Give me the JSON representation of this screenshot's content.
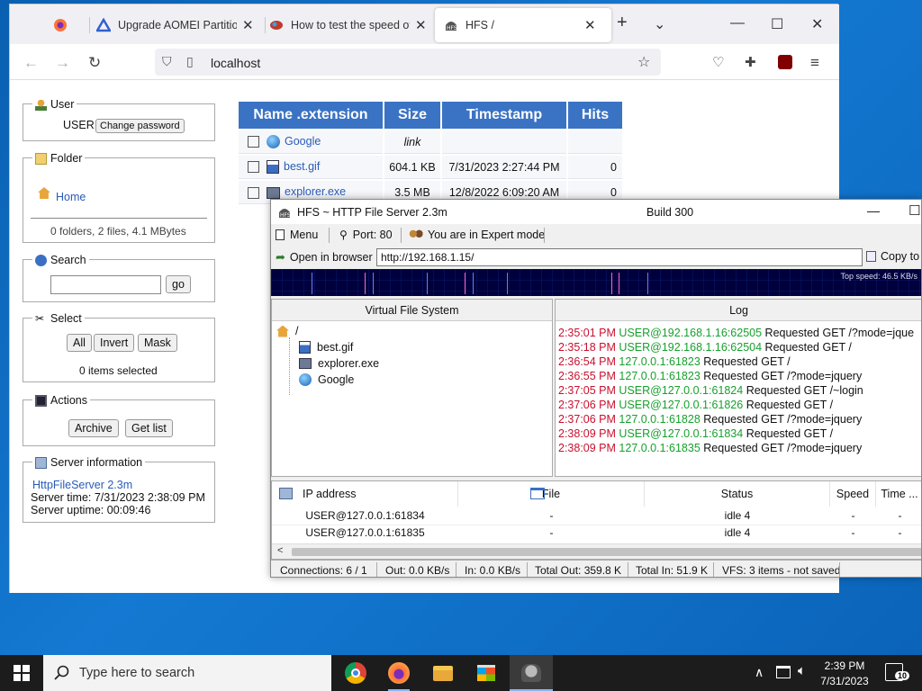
{
  "browser": {
    "tabs": [
      {
        "label": "Upgrade AOMEI Partition"
      },
      {
        "label": "How to test the speed of"
      },
      {
        "label": "HFS /"
      }
    ],
    "address": "localhost"
  },
  "page": {
    "user": {
      "legend": "User",
      "name": "USER",
      "change_password": "Change password"
    },
    "folder": {
      "legend": "Folder",
      "home": "Home",
      "summary": "0 folders, 2 files, 4.1 MBytes"
    },
    "search": {
      "legend": "Search",
      "go": "go"
    },
    "select": {
      "legend": "Select",
      "all": "All",
      "invert": "Invert",
      "mask": "Mask",
      "status": "0 items selected"
    },
    "actions": {
      "legend": "Actions",
      "archive": "Archive",
      "get_list": "Get list"
    },
    "server": {
      "legend": "Server information",
      "link": "HttpFileServer 2.3m",
      "time": "Server time: 7/31/2023 2:38:09 PM",
      "uptime": "Server uptime: 00:09:46"
    },
    "table": {
      "headers": [
        "Name .extension",
        "Size",
        "Timestamp",
        "Hits"
      ],
      "rows": [
        {
          "name": "Google",
          "size": "link",
          "timestamp": "",
          "hits": ""
        },
        {
          "name": "best.gif",
          "size": "604.1 KB",
          "timestamp": "7/31/2023 2:27:44 PM",
          "hits": "0"
        },
        {
          "name": "explorer.exe",
          "size": "3.5 MB",
          "timestamp": "12/8/2022 6:09:20 AM",
          "hits": "0"
        }
      ]
    }
  },
  "hfs": {
    "title": "HFS ~ HTTP File Server 2.3m",
    "build": "Build 300",
    "toolbar": {
      "menu": "Menu",
      "port": "Port: 80",
      "mode": "You are in Expert mode"
    },
    "open_in_browser": "Open in browser",
    "url": "http://192.168.1.15/",
    "copy": "Copy to",
    "top_speed": "Top speed: 46.5 KB/s",
    "vfs": {
      "header": "Virtual File System",
      "root": "/",
      "items": [
        "best.gif",
        "explorer.exe",
        "Google"
      ]
    },
    "log": {
      "header": "Log",
      "lines": [
        {
          "time": "2:35:01 PM",
          "user": "USER@192.168.1.16:62505",
          "msg": "Requested GET /?mode=jque"
        },
        {
          "time": "2:35:18 PM",
          "user": "USER@192.168.1.16:62504",
          "msg": "Requested GET /"
        },
        {
          "time": "2:36:54 PM",
          "user": "127.0.0.1:61823",
          "msg": "Requested GET /"
        },
        {
          "time": "2:36:55 PM",
          "user": "127.0.0.1:61823",
          "msg": "Requested GET /?mode=jquery"
        },
        {
          "time": "2:37:05 PM",
          "user": "USER@127.0.0.1:61824",
          "msg": "Requested GET /~login"
        },
        {
          "time": "2:37:06 PM",
          "user": "USER@127.0.0.1:61826",
          "msg": "Requested GET /"
        },
        {
          "time": "2:37:06 PM",
          "user": "127.0.0.1:61828",
          "msg": "Requested GET /?mode=jquery"
        },
        {
          "time": "2:38:09 PM",
          "user": "USER@127.0.0.1:61834",
          "msg": "Requested GET /"
        },
        {
          "time": "2:38:09 PM",
          "user": "127.0.0.1:61835",
          "msg": "Requested GET /?mode=jquery"
        }
      ]
    },
    "connections": {
      "headers": [
        "IP address",
        "File",
        "Status",
        "Speed",
        "Time ..."
      ],
      "rows": [
        {
          "ip": "USER@127.0.0.1:61834",
          "file": "-",
          "status": "idle 4",
          "speed": "-",
          "time": "-"
        },
        {
          "ip": "USER@127.0.0.1:61835",
          "file": "-",
          "status": "idle 4",
          "speed": "-",
          "time": "-"
        }
      ]
    },
    "statusbar": [
      "Connections: 6 / 1",
      "Out: 0.0 KB/s",
      "In: 0.0 KB/s",
      "Total Out: 359.8 K",
      "Total In: 51.9 K",
      "VFS: 3 items - not saved"
    ]
  },
  "taskbar": {
    "search_placeholder": "Type here to search",
    "time": "2:39 PM",
    "date": "7/31/2023",
    "notifications": "10"
  },
  "colors": {
    "table_header": "#3a73c4",
    "log_time": "#c8102e",
    "log_user": "#16a02c",
    "link": "#2a5bb5"
  }
}
